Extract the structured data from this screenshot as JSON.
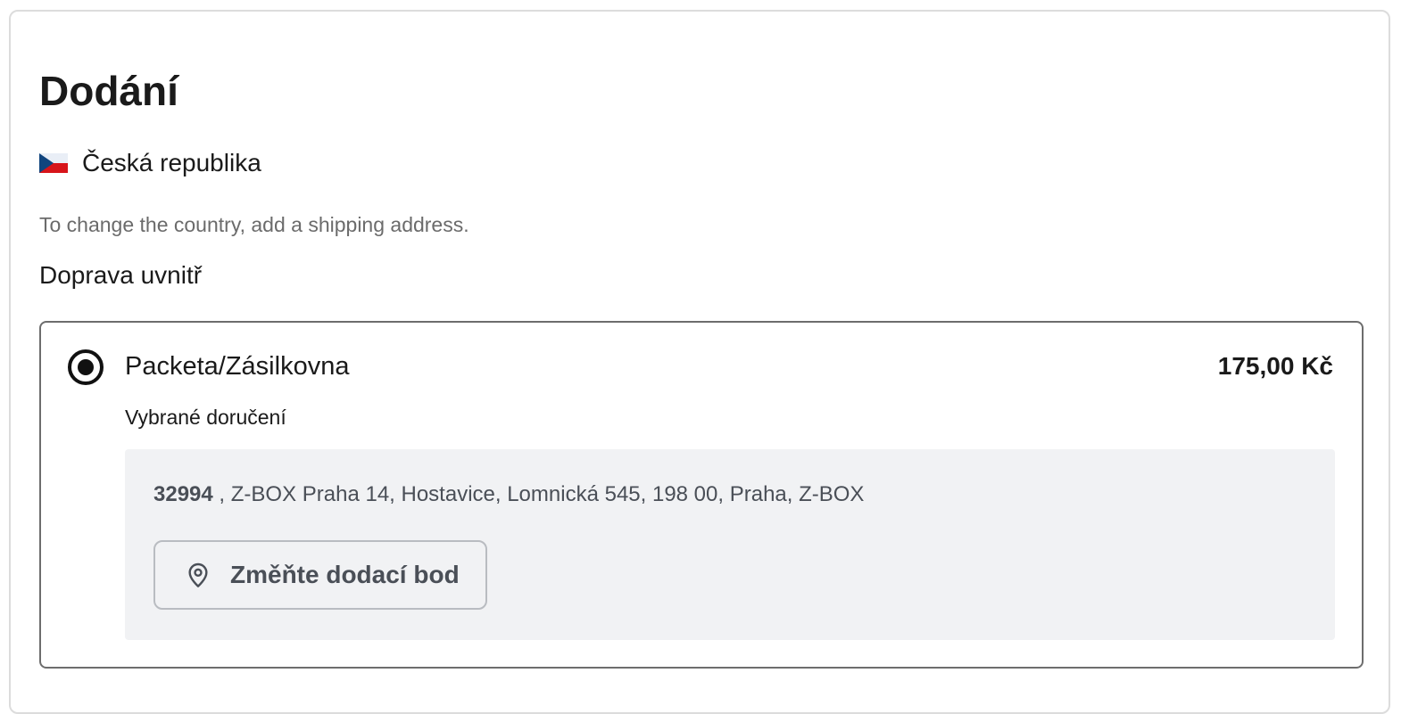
{
  "delivery": {
    "title": "Dodání",
    "country": {
      "name": "Česká republika",
      "flag_icon": "czech-flag-icon"
    },
    "hint": "To change the country, add a shipping address.",
    "section_label": "Doprava uvnitř",
    "method": {
      "name": "Packeta/Zásilkovna",
      "price": "175,00 Kč",
      "selected": true,
      "selected_label": "Vybrané doručení",
      "pickup_point": {
        "id": "32994",
        "address": " , Z-BOX Praha 14, Hostavice, Lomnická 545, 198 00, Praha, Z-BOX"
      },
      "change_button": {
        "label": "Změňte dodací bod",
        "icon": "map-pin-icon"
      }
    }
  },
  "colors": {
    "text_primary": "#1a1a1a",
    "text_muted": "#6b6b6b",
    "panel_bg": "#f1f2f4",
    "box_border": "#6d6d6d",
    "flag_blue": "#11457e",
    "flag_red": "#d7141a"
  }
}
